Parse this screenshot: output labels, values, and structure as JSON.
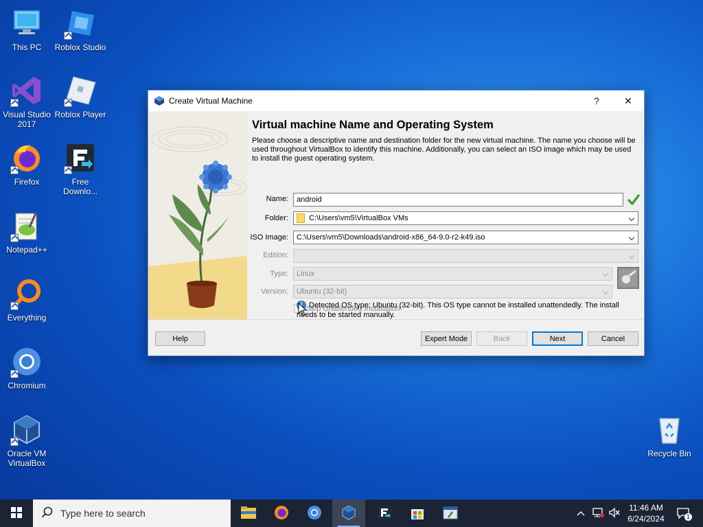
{
  "desktop": {
    "icons": [
      {
        "label": "This PC"
      },
      {
        "label": "Roblox Studio"
      },
      {
        "label": "Visual Studio 2017"
      },
      {
        "label": "Roblox Player"
      },
      {
        "label": "Firefox"
      },
      {
        "label": "Free Downlo..."
      },
      {
        "label": "Notepad++"
      },
      {
        "label": "Everything"
      },
      {
        "label": "Chromium"
      },
      {
        "label": "Oracle VM VirtualBox"
      },
      {
        "label": "Recycle Bin"
      }
    ]
  },
  "dialog": {
    "title": "Create Virtual Machine",
    "help_glyph": "?",
    "close_glyph": "✕",
    "heading": "Virtual machine Name and Operating System",
    "description": "Please choose a descriptive name and destination folder for the new virtual machine. The name you choose will be used throughout VirtualBox to identify this machine. Additionally, you can select an ISO image which may be used to install the guest operating system.",
    "fields": {
      "name": {
        "label": "Name:",
        "value": "android"
      },
      "folder": {
        "label": "Folder:",
        "value": "C:\\Users\\vm5\\VirtualBox VMs"
      },
      "iso": {
        "label": "ISO Image:",
        "value": "C:\\Users\\vm5\\Downloads\\android-x86_64-9.0-r2-k49.iso"
      },
      "edition": {
        "label": "Edition:",
        "value": ""
      },
      "type": {
        "label": "Type:",
        "value": "Linux"
      },
      "version": {
        "label": "Version:",
        "value": "Ubuntu (32-bit)"
      }
    },
    "skip_unattended": {
      "label": "Skip Unattended Installation",
      "checked": false
    },
    "info_text": "Detected OS type: Ubuntu (32-bit). This OS type cannot be installed unattendedly. The install needs to be started manually.",
    "buttons": {
      "help": "Help",
      "expert": "Expert Mode",
      "back": "Back",
      "next": "Next",
      "cancel": "Cancel"
    }
  },
  "taskbar": {
    "search_placeholder": "Type here to search",
    "time": "11:46 AM",
    "date": "6/24/2024",
    "notification_count": "1"
  },
  "colors": {
    "accent": "#0078d7",
    "taskbar": "#1b2434",
    "valid_check": "#3fa33a"
  }
}
